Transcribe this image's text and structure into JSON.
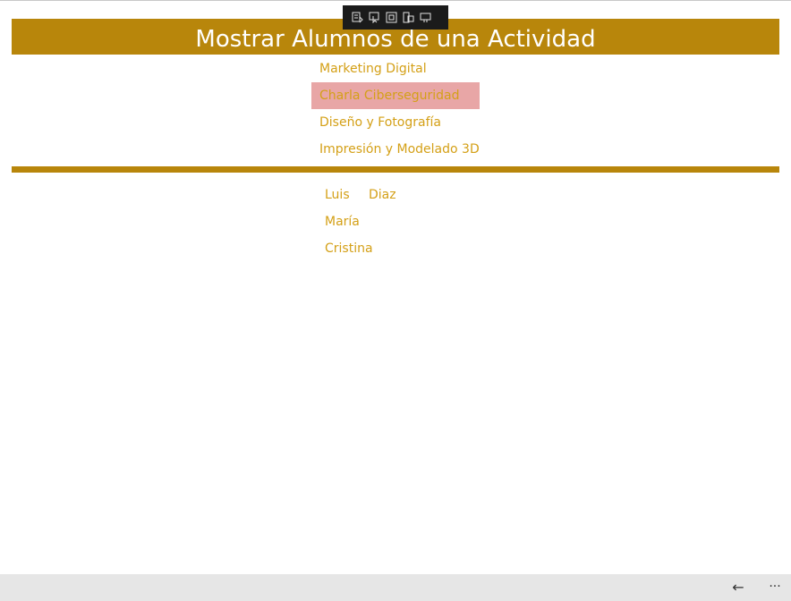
{
  "app": {
    "title": "Mostrar Alumnos de una Actividad"
  },
  "activities": {
    "items": [
      {
        "label": "Marketing Digital",
        "selected": false
      },
      {
        "label": "Charla Ciberseguridad",
        "selected": true
      },
      {
        "label": "Diseño y Fotografía",
        "selected": false
      },
      {
        "label": "Impresión y Modelado 3D",
        "selected": false
      }
    ]
  },
  "students": {
    "items": [
      {
        "first": "Luis",
        "last": "Diaz"
      },
      {
        "first": "María",
        "last": ""
      },
      {
        "first": "Cristina",
        "last": ""
      }
    ]
  },
  "appbar": {
    "back_glyph": "←",
    "more_glyph": "···"
  },
  "colors": {
    "accent": "#b8860b",
    "text_accent": "#d4a017",
    "selection": "#e8a6a6"
  }
}
